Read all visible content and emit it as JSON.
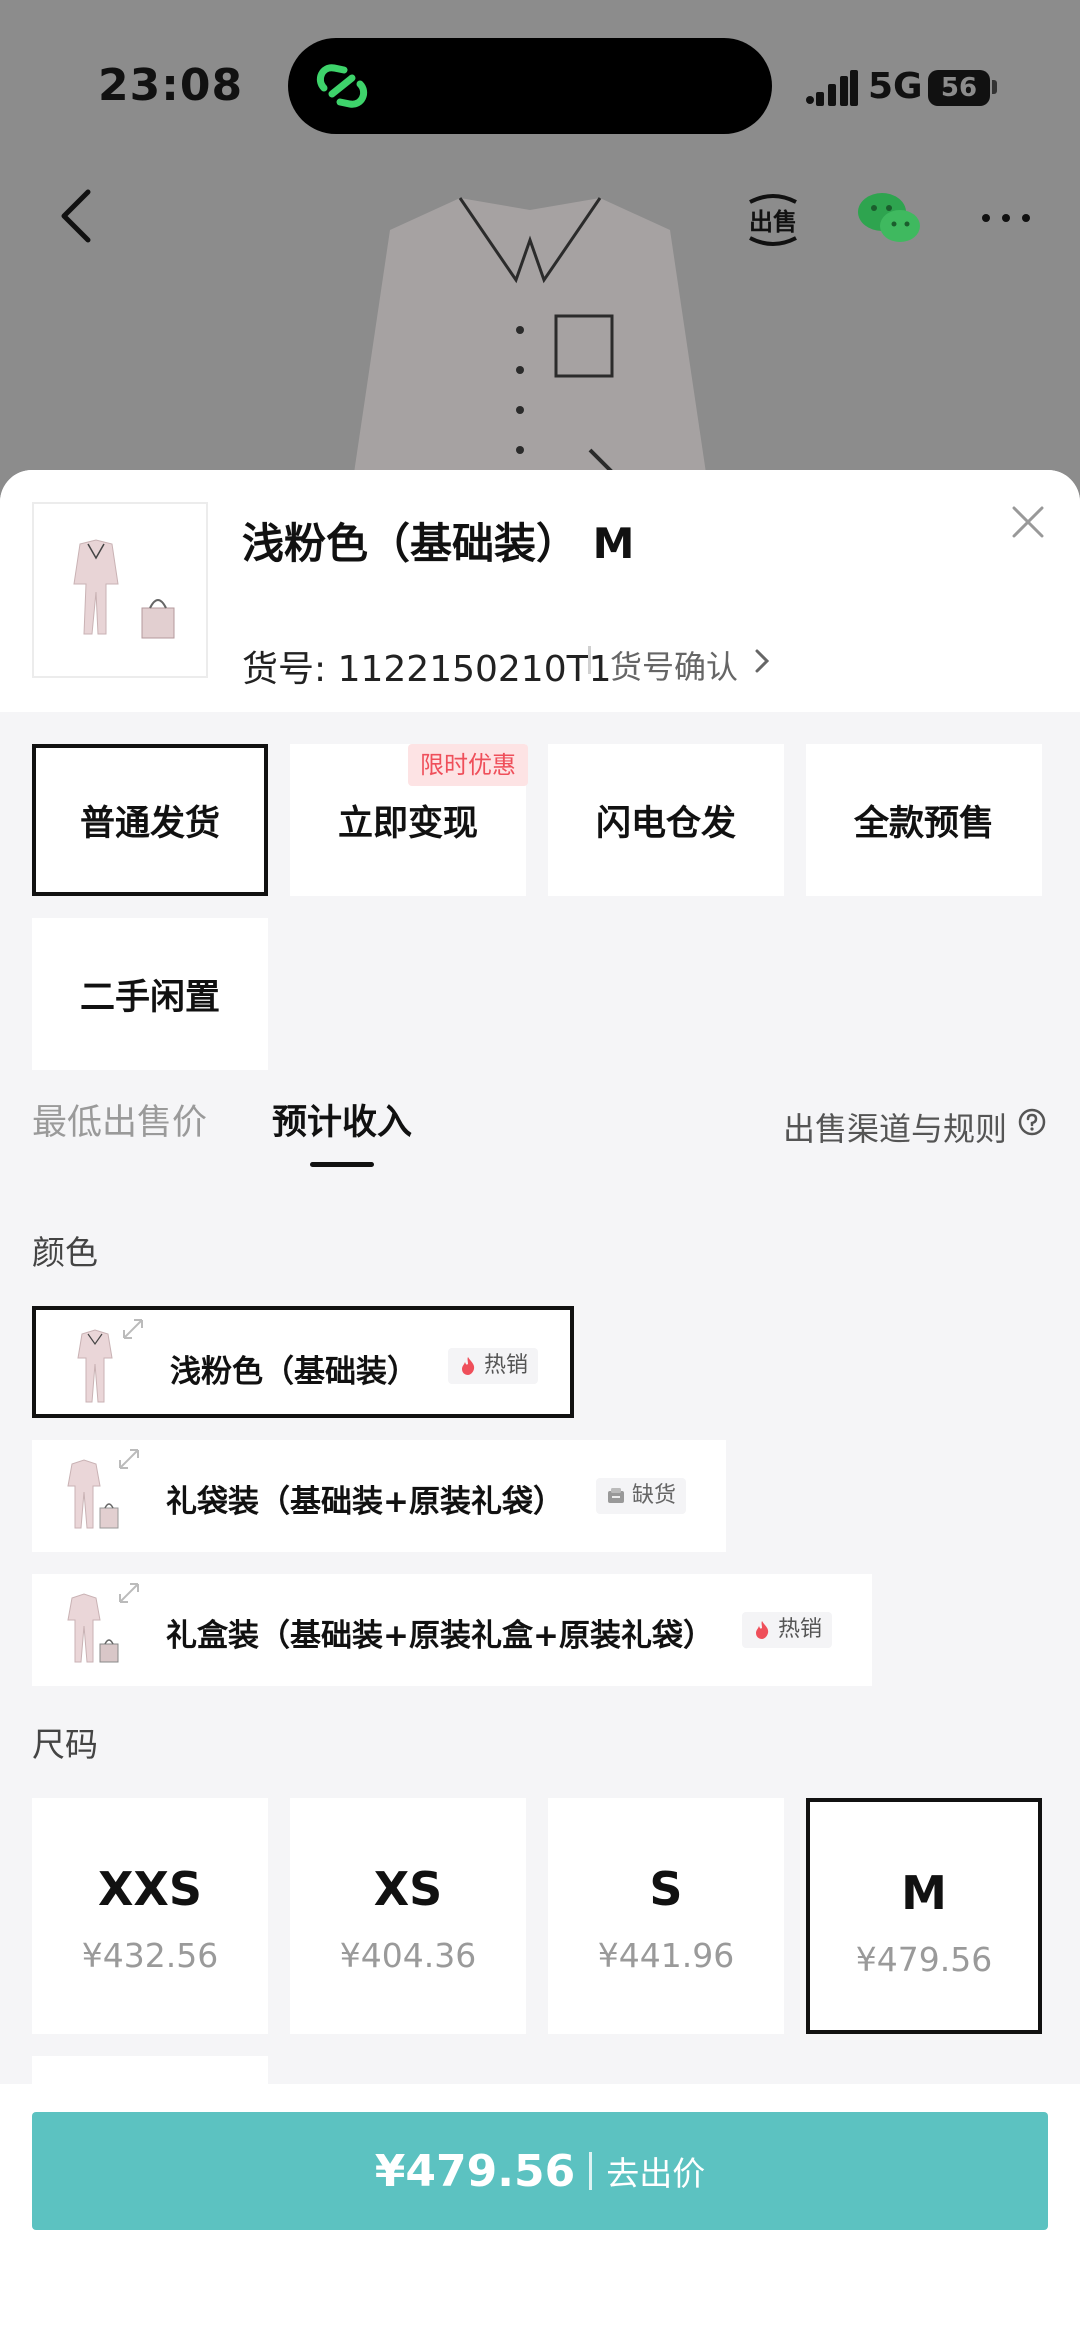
{
  "status_bar": {
    "time": "23:08",
    "network": "5G",
    "battery": "56"
  },
  "nav": {
    "sell_icon": "sell-icon",
    "wechat_icon": "wechat-icon",
    "more_icon": "more-icon"
  },
  "sheet": {
    "title": "浅粉色（基础装） M",
    "sku": "货号: 1122150210T1",
    "sku_confirm": "货号确认"
  },
  "shipping": {
    "promo_badge": "限时优惠",
    "options": [
      "普通发货",
      "立即变现",
      "闪电仓发",
      "全款预售",
      "二手闲置"
    ],
    "selected": "普通发货"
  },
  "tabs": {
    "items": [
      "最低出售价",
      "预计收入"
    ],
    "active": "预计收入",
    "rules": "出售渠道与规则"
  },
  "colors": {
    "label": "颜色",
    "options": [
      {
        "label": "浅粉色（基础装）",
        "badge": "热销",
        "badge_icon": "flame-icon",
        "selected": true
      },
      {
        "label": "礼袋装（基础装+原装礼袋）",
        "badge": "缺货",
        "badge_icon": "box-icon",
        "selected": false
      },
      {
        "label": "礼盒装（基础装+原装礼盒+原装礼袋）",
        "badge": "热销",
        "badge_icon": "flame-icon",
        "selected": false
      }
    ]
  },
  "sizes": {
    "label": "尺码",
    "options": [
      {
        "size": "XXS",
        "price": "¥432.56"
      },
      {
        "size": "XS",
        "price": "¥404.36"
      },
      {
        "size": "S",
        "price": "¥441.96"
      },
      {
        "size": "M",
        "price": "¥479.56"
      }
    ],
    "selected": "M"
  },
  "cta": {
    "price": "¥479.56",
    "label": "去出价"
  },
  "colors_theme": {
    "accent": "#5cc2c1",
    "promo": "#ef4f5a",
    "selected_border": "#111111"
  }
}
